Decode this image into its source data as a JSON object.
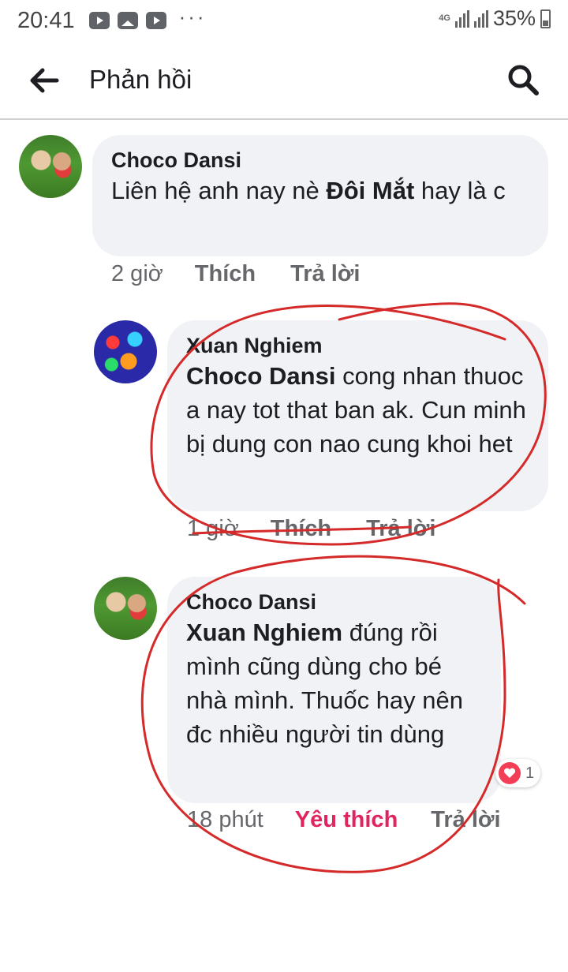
{
  "status_bar": {
    "time": "20:41",
    "network": "4G",
    "battery": "35%",
    "more": "···"
  },
  "header": {
    "title": "Phản hồi"
  },
  "comments": [
    {
      "author": "Choco Dansi",
      "text": "Liên hệ anh nay nè ",
      "mention": "Đôi Mắt",
      "text_after": " hay là c",
      "time": "2 giờ",
      "like_label": "Thích",
      "reply_label": "Trả lời"
    },
    {
      "author": "Xuan Nghiem",
      "mention": "Choco Dansi",
      "text_after": " cong nhan thuoc a nay tot that ban ak. Cun minh bị dung con nao cung khoi het",
      "time": "1 giờ",
      "like_label": "Thích",
      "reply_label": "Trả lời"
    },
    {
      "author": "Choco Dansi",
      "mention": "Xuan Nghiem",
      "text_after": " đúng rồi mình cũng dùng cho bé nhà mình. Thuốc hay nên đc nhiều người tin dùng",
      "time": "18 phút",
      "like_label": "Yêu thích",
      "reply_label": "Trả lời",
      "reaction_count": "1"
    }
  ],
  "colors": {
    "bubble": "#f0f2f5",
    "love_reaction": "#e0245e",
    "annotation": "#d42a2a"
  }
}
